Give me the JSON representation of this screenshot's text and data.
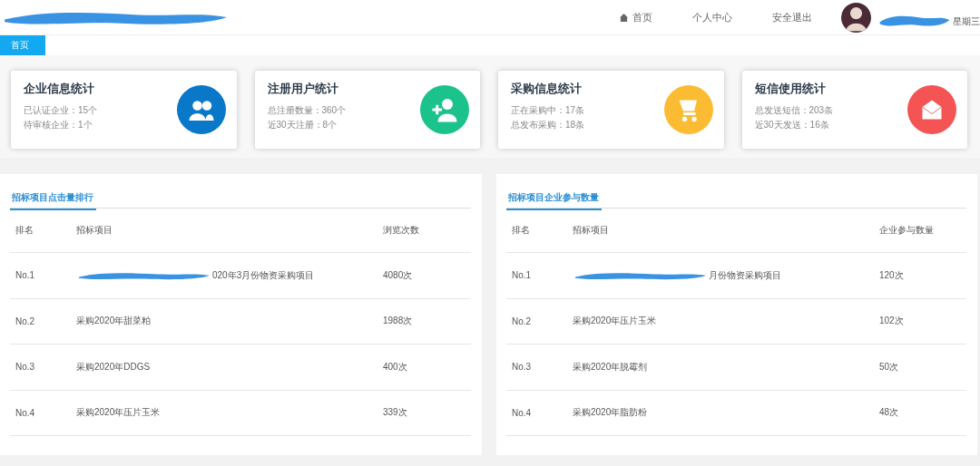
{
  "header": {
    "nav": [
      {
        "label": "首页",
        "kind": "home"
      },
      {
        "label": "个人中心",
        "kind": "plain"
      },
      {
        "label": "安全退出",
        "kind": "plain"
      }
    ],
    "user": {
      "weekday": "星期三"
    }
  },
  "tabs": [
    {
      "label": "首页",
      "selected": true
    }
  ],
  "cards": [
    {
      "title": "企业信息统计",
      "lines": [
        "已认证企业：15个",
        "待审核企业：1个"
      ],
      "kind": "group",
      "color": "#0a78c8"
    },
    {
      "title": "注册用户统计",
      "lines": [
        "总注册数量：360个",
        "近30天注册：8个"
      ],
      "kind": "adduser",
      "color": "#1cc28b"
    },
    {
      "title": "采购信息统计",
      "lines": [
        "正在采购中：17条",
        "总发布采购：18条"
      ],
      "kind": "cart",
      "color": "#fbbc33"
    },
    {
      "title": "短信使用统计",
      "lines": [
        "总发送短信：203条",
        "近30天发送：16条"
      ],
      "kind": "mail",
      "color": "#f45453"
    }
  ],
  "panels": [
    {
      "title": "招标项目点击量排行",
      "columns": [
        "排名",
        "招标项目",
        "浏览次数"
      ],
      "rows": [
        {
          "cells": [
            "No.1",
            "020年3月份物资采购项目",
            "4080次"
          ],
          "redacted": true
        },
        {
          "cells": [
            "No.2",
            "采购2020年甜菜粕",
            "1988次"
          ],
          "redacted": false
        },
        {
          "cells": [
            "No.3",
            "采购2020年DDGS",
            "400次"
          ],
          "redacted": false
        },
        {
          "cells": [
            "No.4",
            "采购2020年压片玉米",
            "339次"
          ],
          "redacted": false
        }
      ]
    },
    {
      "title": "招标项目企业参与数量",
      "columns": [
        "排名",
        "招标项目",
        "企业参与数量"
      ],
      "rows": [
        {
          "cells": [
            "No.1",
            "月份物资采购项目",
            "120次"
          ],
          "redacted": true
        },
        {
          "cells": [
            "No.2",
            "采购2020年压片玉米",
            "102次"
          ],
          "redacted": false
        },
        {
          "cells": [
            "No.3",
            "采购2020年脱霉剂",
            "50次"
          ],
          "redacted": false
        },
        {
          "cells": [
            "No.4",
            "采购2020年脂肪粉",
            "48次"
          ],
          "redacted": false
        }
      ]
    }
  ]
}
